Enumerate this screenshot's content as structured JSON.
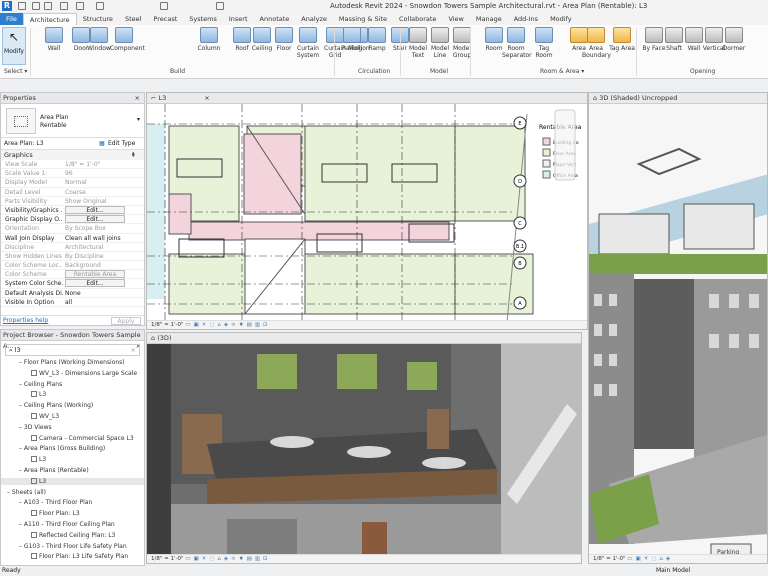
{
  "app": {
    "title": "Autodesk Revit 2024 - Snowdon Towers Sample Architectural.rvt - Area Plan (Rentable): L3",
    "logo": "R"
  },
  "tabs": [
    "File",
    "Architecture",
    "Structure",
    "Steel",
    "Precast",
    "Systems",
    "Insert",
    "Annotate",
    "Analyze",
    "Massing & Site",
    "Collaborate",
    "View",
    "Manage",
    "Add-Ins",
    "Modify"
  ],
  "active_tab": "Architecture",
  "ribbon": {
    "select": {
      "modify": "Modify",
      "label": "Select ▾"
    },
    "build": {
      "label": "Build",
      "tools": [
        "Wall",
        "Door",
        "Window",
        "Component",
        "Column",
        "Roof",
        "Ceiling",
        "Floor",
        "Curtain System",
        "Curtain Grid",
        "Mullion"
      ]
    },
    "circulation": {
      "label": "Circulation",
      "tools": [
        "Railing",
        "Ramp",
        "Stair"
      ]
    },
    "model": {
      "label": "Model",
      "tools": [
        "Model Text",
        "Model Line",
        "Model Group"
      ]
    },
    "room_area": {
      "label": "Room & Area ▾",
      "tools": [
        "Room",
        "Room Separator",
        "Tag Room",
        "Area",
        "Area Boundary",
        "Tag Area"
      ]
    },
    "opening": {
      "label": "Opening",
      "tools": [
        "By Face",
        "Shaft",
        "Wall",
        "Vertical",
        "Dormer"
      ]
    }
  },
  "properties": {
    "header": "Properties",
    "type_name": "Area Plan",
    "type_sub": "Rentable",
    "selector": "Area Plan: L3",
    "edit_type": "Edit Type",
    "group": "Graphics",
    "rows": [
      {
        "k": "View Scale",
        "v": "1/8\" = 1'-0\"",
        "dim": true
      },
      {
        "k": "Scale Value  1:",
        "v": "96",
        "dim": true
      },
      {
        "k": "Display Model",
        "v": "Normal",
        "dim": true
      },
      {
        "k": "Detail Level",
        "v": "Coarse",
        "dim": true
      },
      {
        "k": "Parts Visibility",
        "v": "Show Original",
        "dim": true
      },
      {
        "k": "Visibility/Graphics ...",
        "v": "Edit...",
        "btn": true
      },
      {
        "k": "Graphic Display O...",
        "v": "Edit...",
        "btn": true
      },
      {
        "k": "Orientation",
        "v": "By Scope Box",
        "dim": true
      },
      {
        "k": "Wall Join Display",
        "v": "Clean all wall joins"
      },
      {
        "k": "Discipline",
        "v": "Architectural",
        "dim": true
      },
      {
        "k": "Show Hidden Lines",
        "v": "By Discipline",
        "dim": true
      },
      {
        "k": "Color Scheme Loc...",
        "v": "Background",
        "dim": true
      },
      {
        "k": "Color Scheme",
        "v": "Rentable Area",
        "dim": true,
        "btn": true
      },
      {
        "k": "System Color Sche...",
        "v": "Edit...",
        "btn": true
      },
      {
        "k": "Default Analysis Di...",
        "v": "None"
      },
      {
        "k": "Visible In Option",
        "v": "all"
      }
    ],
    "help": "Properties help",
    "apply": "Apply"
  },
  "browser": {
    "header": "Project Browser - Snowdon Towers Sample A...",
    "search": "l3",
    "items": [
      {
        "t": "Floor Plans (Working Dimensions)",
        "lvl": 1
      },
      {
        "t": "WV_L3 - Dimensions Large Scale",
        "lvl": 2
      },
      {
        "t": "Ceiling Plans",
        "lvl": 1
      },
      {
        "t": "L3",
        "lvl": 2
      },
      {
        "t": "Ceiling Plans (Working)",
        "lvl": 1
      },
      {
        "t": "WV_L3",
        "lvl": 2
      },
      {
        "t": "3D Views",
        "lvl": 1
      },
      {
        "t": "Camera - Commercial Space L3",
        "lvl": 2
      },
      {
        "t": "Area Plans (Gross Building)",
        "lvl": 1
      },
      {
        "t": "L3",
        "lvl": 2
      },
      {
        "t": "Area Plans (Rentable)",
        "lvl": 1
      },
      {
        "t": "L3",
        "lvl": 2,
        "selected": true
      },
      {
        "t": "Sheets (all)",
        "lvl": 0
      },
      {
        "t": "A103 - Third Floor Plan",
        "lvl": 1
      },
      {
        "t": "Floor Plan: L3",
        "lvl": 2
      },
      {
        "t": "A110 - Third Floor Ceiling Plan",
        "lvl": 1
      },
      {
        "t": "Reflected Ceiling Plan: L3",
        "lvl": 2
      },
      {
        "t": "G103 - Third Floor Life Safety Plan",
        "lvl": 1
      },
      {
        "t": "Floor Plan: L3 Life Safety Plan",
        "lvl": 2
      }
    ]
  },
  "views": {
    "plan": {
      "tab": "L3",
      "scale": "1/8\" = 1'-0\"",
      "legend_title": "Rentable Area",
      "legend": [
        "Building Co",
        "Floor Area",
        "Major Vert",
        "Office Area"
      ],
      "legend_colors": [
        "#f3d3dc",
        "#e8f2d8",
        "#f0f0f0",
        "#d8eef0"
      ],
      "grids": [
        "E",
        "D",
        "C",
        "B.1",
        "B",
        "A"
      ]
    },
    "camera": {
      "tab": "(3D)",
      "scale": "1/8\" = 1'-0\""
    },
    "shaded": {
      "tab": "3D (Shaded) Uncropped",
      "scale": "1/8\" = 1'-0\"",
      "sign": "Parking"
    }
  },
  "status": {
    "text": "Ready",
    "model": "Main Model"
  }
}
